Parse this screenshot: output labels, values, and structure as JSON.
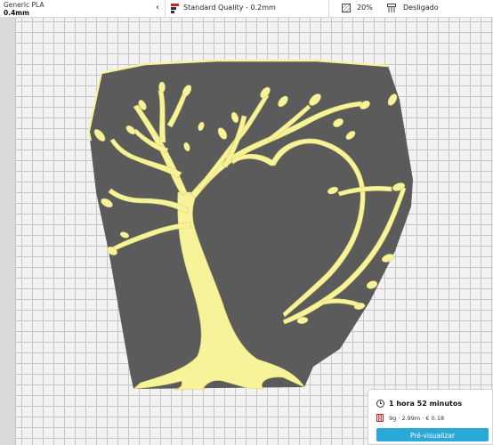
{
  "toolbar": {
    "material_name": "Generic PLA",
    "nozzle_size": "0.4mm",
    "quality_label": "Standard Quality - 0.2mm",
    "infill_label": "20%",
    "support_label": "Desligado"
  },
  "print_panel": {
    "time_label": "1 hora 52 minutos",
    "cost_label": "9g · 2.99m · € 0.18",
    "preview_button_label": "Pré-visualizar"
  },
  "colors": {
    "model_yellow": "#f6f39a",
    "shadow_gray": "#5b5b5b",
    "accent_blue": "#2aa8d8",
    "quality_red": "#c62828"
  },
  "icons": {
    "material_chevron": "chevron-left-icon",
    "quality": "quality-profile-icon",
    "infill": "infill-icon",
    "support": "support-icon",
    "time": "clock-icon",
    "material_cost": "spool-icon"
  }
}
